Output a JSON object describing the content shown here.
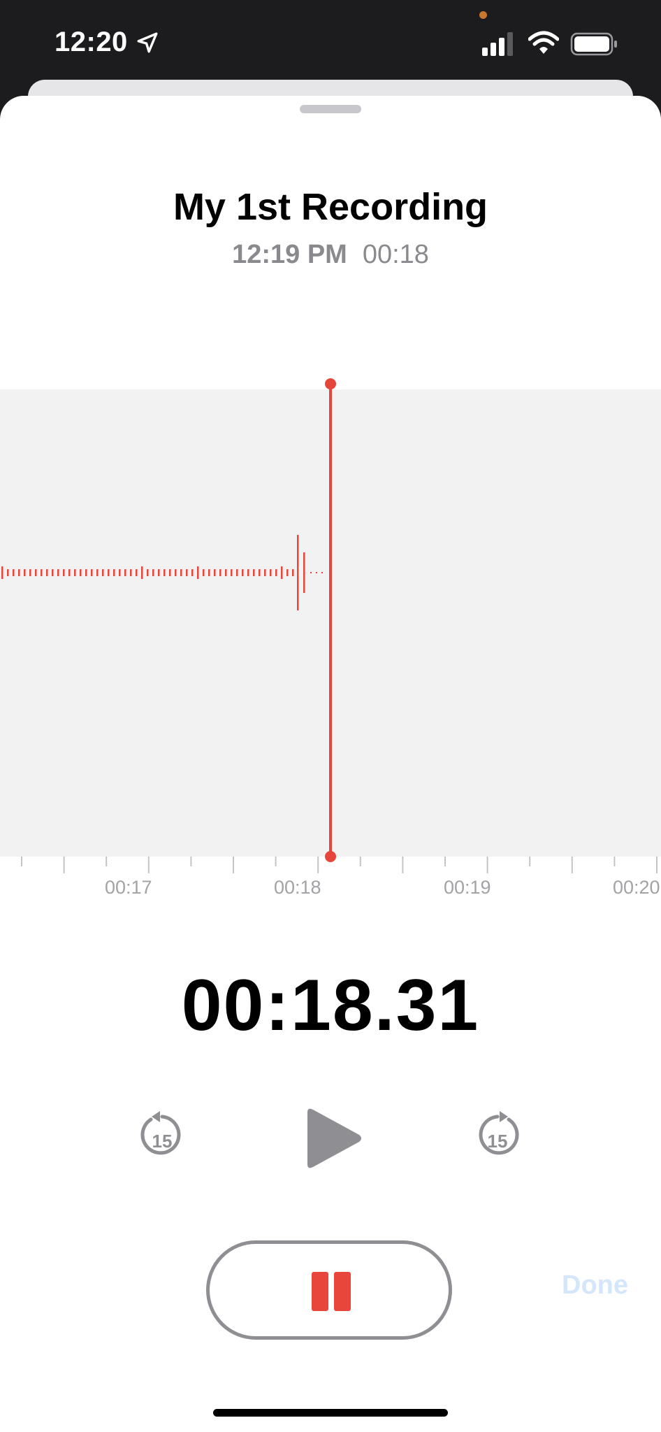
{
  "status_bar": {
    "time": "12:20",
    "icons": [
      "location-arrow-icon",
      "camera-indicator-dot",
      "cellular-signal-icon",
      "wifi-icon",
      "battery-icon"
    ],
    "camera_dot_color": "#c7772f"
  },
  "recording": {
    "title": "My 1st Recording",
    "date": "12:19 PM",
    "duration": "00:18",
    "current_time": "00:18.31"
  },
  "timeline": {
    "labels": [
      "00:17",
      "00:18",
      "00:19",
      "00:20"
    ]
  },
  "controls": {
    "skip_back_seconds": "15",
    "skip_forward_seconds": "15",
    "done_label": "Done"
  },
  "colors": {
    "accent_red": "#e5453a",
    "done_disabled": "#d4e6fb",
    "secondary_text": "#8a8a8e",
    "waveform_bg": "#f2f2f3"
  }
}
